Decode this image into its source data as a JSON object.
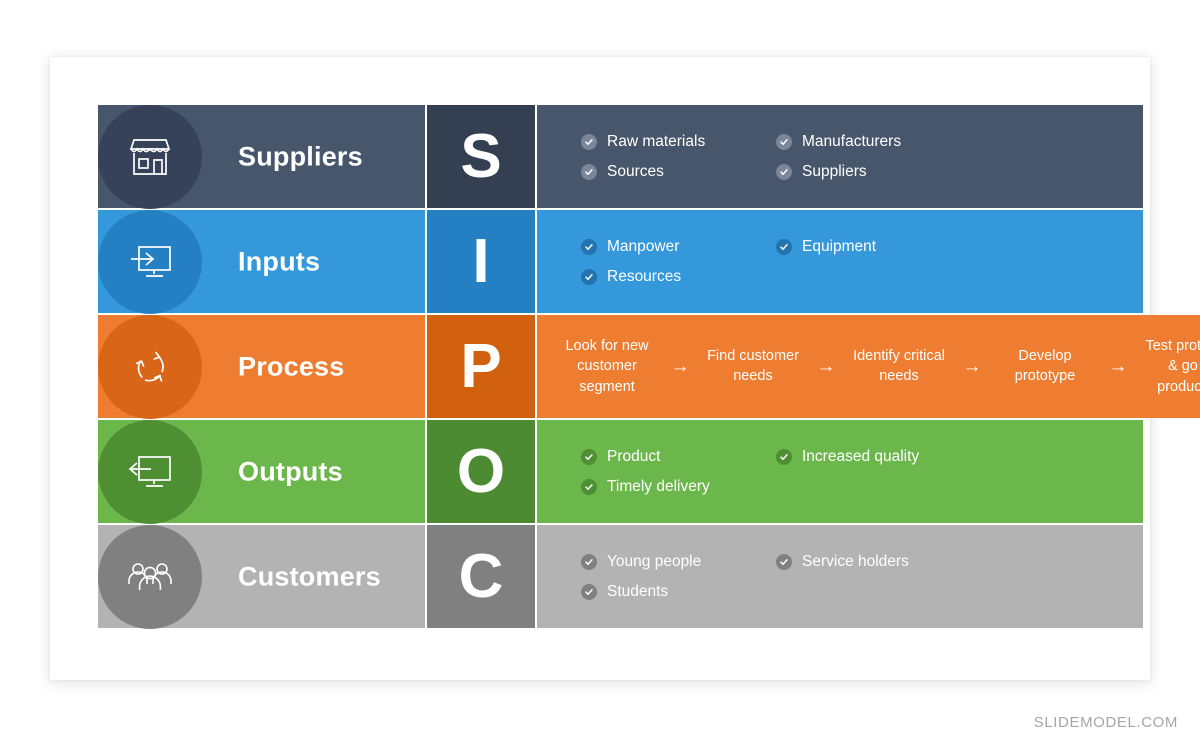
{
  "footer": {
    "watermark": "SLIDEMODEL.COM"
  },
  "diagram": {
    "type": "SIPOC",
    "rows": [
      {
        "id": "suppliers",
        "label": "Suppliers",
        "letter": "S",
        "icon": "storefront-icon",
        "colors": {
          "bar": "#47566b",
          "circle": "#36425a",
          "letter_cell": "#343f52",
          "content": "#47566b",
          "bullet": "#7b869b"
        },
        "content_type": "bullets",
        "bullets": [
          "Raw materials",
          "Sources",
          "Manufacturers",
          "Suppliers"
        ]
      },
      {
        "id": "inputs",
        "label": "Inputs",
        "letter": "I",
        "icon": "monitor-arrow-in-icon",
        "colors": {
          "bar": "#3498db",
          "circle": "#2580c3",
          "letter_cell": "#2580c3",
          "content": "#3498db",
          "bullet": "#2273ae"
        },
        "content_type": "bullets",
        "bullets": [
          "Manpower",
          "Resources",
          "Equipment"
        ]
      },
      {
        "id": "process",
        "label": "Process",
        "letter": "P",
        "icon": "cycle-arrows-icon",
        "colors": {
          "bar": "#ef7d31",
          "circle": "#d96518",
          "letter_cell": "#d1610f",
          "content": "#ef7d31",
          "bullet": "#ffffff"
        },
        "content_type": "process",
        "steps": [
          "Look for new customer segment",
          "Find customer needs",
          "Identify critical needs",
          "Develop prototype",
          "Test prototype & go to production"
        ],
        "arrow": "→"
      },
      {
        "id": "outputs",
        "label": "Outputs",
        "letter": "O",
        "icon": "monitor-arrow-out-icon",
        "colors": {
          "bar": "#6cb74b",
          "circle": "#4e8f33",
          "letter_cell": "#4d8b32",
          "content": "#6cb74b",
          "bullet": "#4e8f33"
        },
        "content_type": "bullets",
        "bullets": [
          "Product",
          "Timely delivery",
          "Increased quality"
        ]
      },
      {
        "id": "customers",
        "label": "Customers",
        "letter": "C",
        "icon": "people-group-icon",
        "colors": {
          "bar": "#b3b3b3",
          "circle": "#808080",
          "letter_cell": "#808080",
          "content": "#b3b3b3",
          "bullet": "#808080"
        },
        "content_type": "bullets",
        "bullets": [
          "Young people",
          "Students",
          "Service holders"
        ]
      }
    ]
  }
}
